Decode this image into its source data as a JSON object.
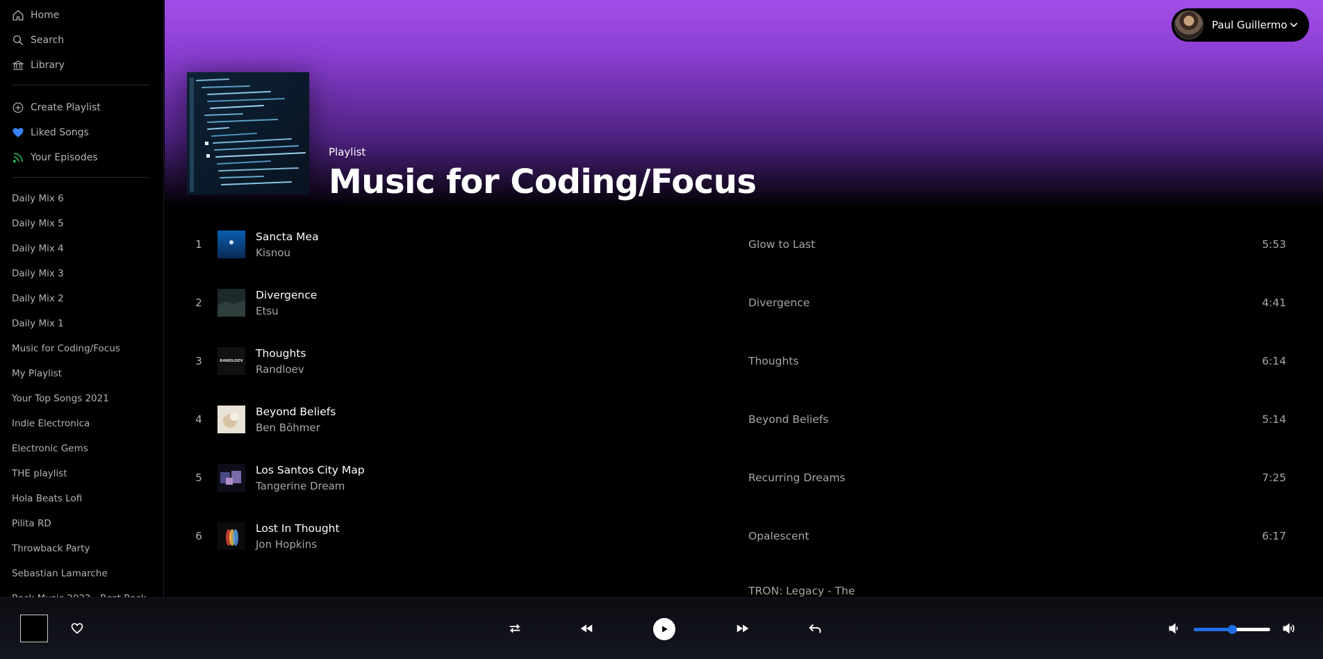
{
  "sidebar": {
    "nav": [
      {
        "label": "Home",
        "icon": "home-icon"
      },
      {
        "label": "Search",
        "icon": "search-icon"
      },
      {
        "label": "Library",
        "icon": "library-icon"
      }
    ],
    "actions": [
      {
        "label": "Create Playlist",
        "icon": "plus-circle-icon"
      },
      {
        "label": "Liked Songs",
        "icon": "heart-icon"
      },
      {
        "label": "Your Episodes",
        "icon": "rss-icon"
      }
    ],
    "playlists": [
      "Daily Mix 6",
      "Daily Mix 5",
      "Daily Mix 4",
      "Daily Mix 3",
      "Daily Mix 2",
      "Daily Mix 1",
      "Music for Coding/Focus",
      "My Playlist",
      "Your Top Songs 2021",
      "Indie Electronica",
      "Electronic Gems",
      "THE playlist",
      "Hola Beats Lofi",
      "Pilita RD",
      "Throwback Party",
      "Sebastian Lamarche",
      "Rock Music 2022 - Best Rock-"
    ]
  },
  "user": {
    "name": "Paul Guillermo"
  },
  "playlist": {
    "type": "Playlist",
    "title": "Music for Coding/Focus",
    "tracks": [
      {
        "num": "1",
        "title": "Sancta Mea",
        "artist": "Kisnou",
        "album": "Glow to Last",
        "duration": "5:53",
        "thumb_label": ""
      },
      {
        "num": "2",
        "title": "Divergence",
        "artist": "Etsu",
        "album": "Divergence",
        "duration": "4:41",
        "thumb_label": ""
      },
      {
        "num": "3",
        "title": "Thoughts",
        "artist": "Randloev",
        "album": "Thoughts",
        "duration": "6:14",
        "thumb_label": "RANDLOEV"
      },
      {
        "num": "4",
        "title": "Beyond Beliefs",
        "artist": "Ben Böhmer",
        "album": "Beyond Beliefs",
        "duration": "5:14",
        "thumb_label": ""
      },
      {
        "num": "5",
        "title": "Los Santos City Map",
        "artist": "Tangerine Dream",
        "album": "Recurring Dreams",
        "duration": "7:25",
        "thumb_label": ""
      },
      {
        "num": "6",
        "title": "Lost In Thought",
        "artist": "Jon Hopkins",
        "album": "Opalescent",
        "duration": "6:17",
        "thumb_label": ""
      }
    ],
    "partial_album": "TRON: Legacy - The"
  },
  "player": {
    "volume": 0.5,
    "colors": {
      "accent": "#1e6fe6",
      "gradient_top": "#a24fe9"
    }
  }
}
